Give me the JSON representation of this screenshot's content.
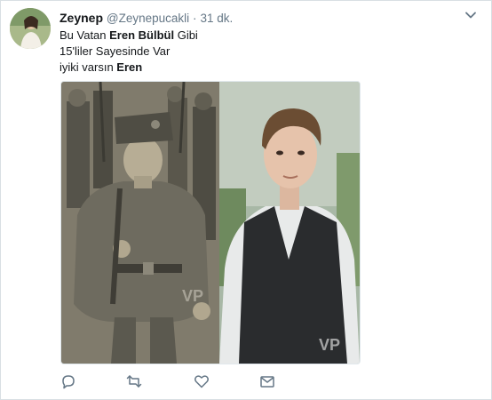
{
  "tweet": {
    "display_name": "Zeynep",
    "handle": "@Zeynepucakli",
    "separator": "·",
    "time": "31 dk.",
    "lines": [
      {
        "before": "Bu Vatan ",
        "bold": "Eren Bülbül",
        "after": " Gibi"
      },
      {
        "before": "15'liler Sayesinde Var",
        "bold": "",
        "after": ""
      },
      {
        "before": "iyiki varsın ",
        "bold": "Eren",
        "after": ""
      }
    ],
    "media": {
      "left_photo": "historic-child-soldier-photo",
      "right_photo": "boy-in-vest-photo",
      "watermark_left": "VP",
      "watermark_right": "VP"
    }
  },
  "icons": {
    "caret": "chevron-down-icon",
    "reply": "reply-icon",
    "retweet": "retweet-icon",
    "like": "heart-icon",
    "message": "envelope-icon"
  },
  "colors": {
    "text": "#14171a",
    "muted": "#657786",
    "border": "#e1e8ed"
  }
}
